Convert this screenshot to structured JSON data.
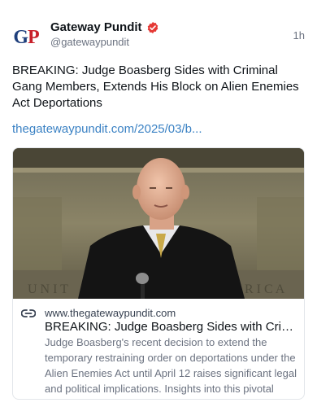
{
  "author": {
    "display_name": "Gateway Pundit",
    "handle": "@gatewaypundit",
    "avatar_text": "GP",
    "verified": true
  },
  "post": {
    "timestamp": "1h",
    "text": "BREAKING: Judge Boasberg Sides with Criminal Gang Members, Extends His Block on Alien Enemies Act Deportations",
    "link_text": "thegatewaypundit.com/2025/03/b..."
  },
  "link_card": {
    "domain": "www.thegatewaypundit.com",
    "title": "BREAKING: Judge Boasberg Sides with Crimin...",
    "description": "Judge Boasberg's recent decision to extend the temporary restraining order on deportations under the Alien Enemies Act until April 12 raises significant legal and political implications. Insights into this pivotal ruli...",
    "image_alt": "Judge in black robe speaking at a podium"
  },
  "colors": {
    "link": "#3b82c4",
    "verified_badge": "#e53935",
    "avatar_blue": "#1f3f7c",
    "avatar_red": "#c8202a"
  }
}
